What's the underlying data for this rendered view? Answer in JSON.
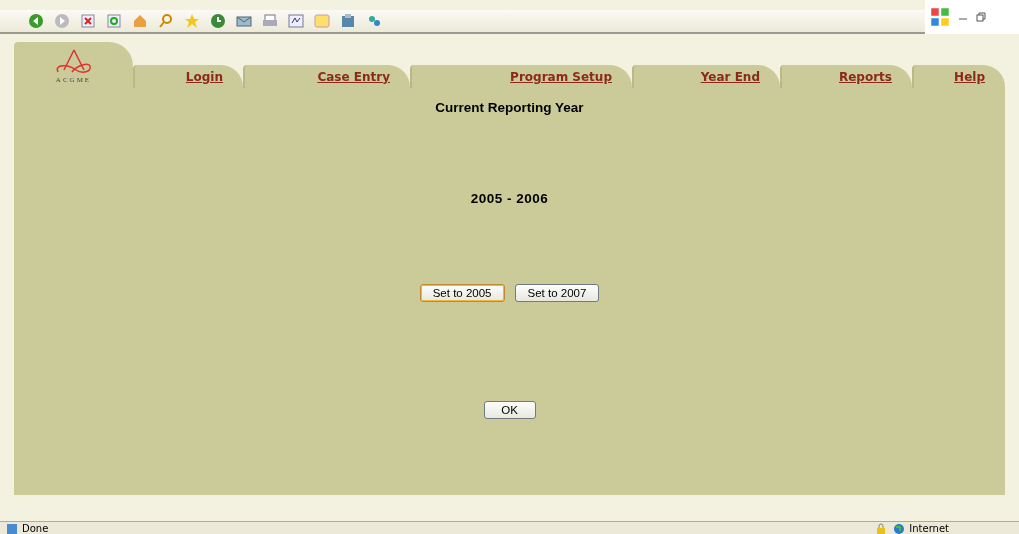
{
  "logo": {
    "text": "ACGME"
  },
  "tabs": [
    {
      "label": "Login"
    },
    {
      "label": "Case Entry"
    },
    {
      "label": "Program Setup"
    },
    {
      "label": "Year End"
    },
    {
      "label": "Reports"
    },
    {
      "label": "Help"
    }
  ],
  "heading": "Current Reporting Year",
  "year": "2005 - 2006",
  "year_buttons": [
    {
      "label": "Set to 2005",
      "focused": true
    },
    {
      "label": "Set to 2007",
      "focused": false
    }
  ],
  "ok_button": {
    "label": "OK"
  },
  "status_bar": {
    "status": "Done",
    "zone": "Internet"
  }
}
